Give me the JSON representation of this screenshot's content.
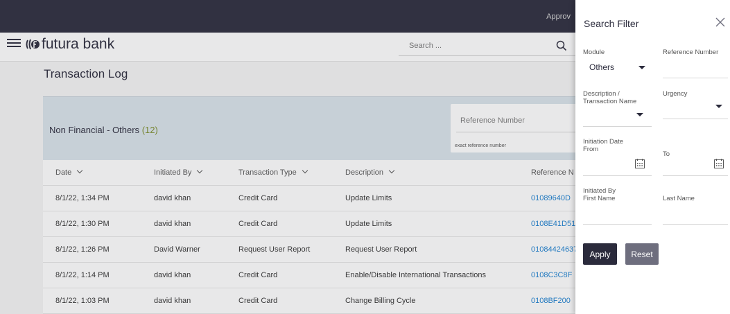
{
  "topbar": {
    "truncated_text": "Approv"
  },
  "brand": {
    "name": "futura bank",
    "menu_icon": "hamburger-icon",
    "logo_icon": "futura-logo-icon"
  },
  "search": {
    "placeholder": "Search ...",
    "icon": "search-icon"
  },
  "page": {
    "title": "Transaction Log"
  },
  "summary": {
    "label": "Non Financial - Others",
    "count": "(12)",
    "reference_label": "Reference Number",
    "reference_hint": "exact reference number"
  },
  "table": {
    "headers": {
      "date": "Date",
      "initiated_by": "Initiated By",
      "transaction_type": "Transaction Type",
      "description": "Description",
      "reference": "Reference N"
    },
    "rows": [
      {
        "date": "8/1/22, 1:34 PM",
        "initiated_by": "david khan",
        "transaction_type": "Credit Card",
        "description": "Update Limits",
        "reference": "01089640D"
      },
      {
        "date": "8/1/22, 1:30 PM",
        "initiated_by": "david khan",
        "transaction_type": "Credit Card",
        "description": "Update Limits",
        "reference": "0108E41D51"
      },
      {
        "date": "8/1/22, 1:26 PM",
        "initiated_by": "David Warner",
        "transaction_type": "Request User Report",
        "description": "Request User Report",
        "reference": "01084424637"
      },
      {
        "date": "8/1/22, 1:14 PM",
        "initiated_by": "david khan",
        "transaction_type": "Credit Card",
        "description": "Enable/Disable International Transactions",
        "reference": "0108C3C8F"
      },
      {
        "date": "8/1/22, 1:03 PM",
        "initiated_by": "david khan",
        "transaction_type": "Credit Card",
        "description": "Change Billing Cycle",
        "reference": "0108BF200"
      }
    ]
  },
  "filter": {
    "title": "Search Filter",
    "module_label": "Module",
    "module_value": "Others",
    "reference_label": "Reference Number",
    "description_label_1": "Description /",
    "description_label_2": "Transaction Name",
    "urgency_label": "Urgency",
    "initiation_from_label_1": "Initiation Date",
    "initiation_from_label_2": "From",
    "to_label": "To",
    "initiated_by_label_1": "Initiated By",
    "initiated_by_label_2": "First Name",
    "last_name_label": "Last Name",
    "apply_label": "Apply",
    "reset_label": "Reset"
  },
  "colors": {
    "topbar": "#2b2b3c",
    "summary_bg": "#d9e3ea",
    "count_accent": "#7c8c2a",
    "link": "#1a7fd0",
    "apply_button": "#2b2b3c",
    "reset_button": "#6e6e7e"
  }
}
